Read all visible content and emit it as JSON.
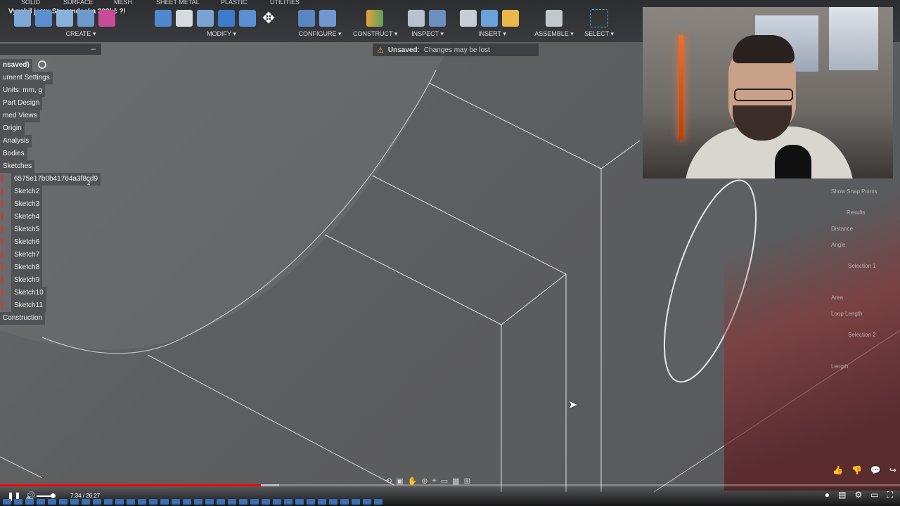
{
  "video_title": "Vyrobil jsem Streamdecka 200kč ?!",
  "top_tabs": [
    "SOLID",
    "SURFACE",
    "MESH",
    "SHEET METAL",
    "PLASTIC",
    "UTILITIES"
  ],
  "toolbar_groups": {
    "create": "CREATE ▾",
    "modify": "MODIFY ▾",
    "configure": "CONFIGURE ▾",
    "construct": "CONSTRUCT ▾",
    "inspect": "INSPECT ▾",
    "insert": "INSERT ▾",
    "assemble": "ASSEMBLE ▾",
    "select": "SELECT ▾"
  },
  "warning": {
    "title": "Unsaved:",
    "message": "Changes may be lost",
    "icon": "warning-icon"
  },
  "browser": {
    "collapse": "–",
    "root": "nsaved)",
    "items": [
      "ument Settings",
      "Units: mm, g",
      "Part Design",
      "med Views",
      "Origin",
      "Analysis",
      "Bodies",
      "Sketches"
    ],
    "sketch_first": "6575e17b0b41764a3f8cd9",
    "sketch_first_count": "2",
    "sketches": [
      "Sketch2",
      "Sketch3",
      "Sketch4",
      "Sketch5",
      "Sketch6",
      "Sketch7",
      "Sketch8",
      "Sketch9",
      "Sketch10",
      "Sketch11"
    ],
    "construction": "Construction"
  },
  "right_panel": [
    "Show Snap Points",
    "Results",
    "Distance",
    "Angle",
    "Selection 1",
    "Area",
    "Loop Length",
    "Selection 2",
    "Length"
  ],
  "player": {
    "time": "7:34 / 26:27",
    "played_fraction": 0.29,
    "loaded_fraction": 0.31
  },
  "colors": {
    "accent_red": "#ff0000",
    "toolbar_bg": "#2c2d30",
    "warning": "#f5b82e"
  }
}
